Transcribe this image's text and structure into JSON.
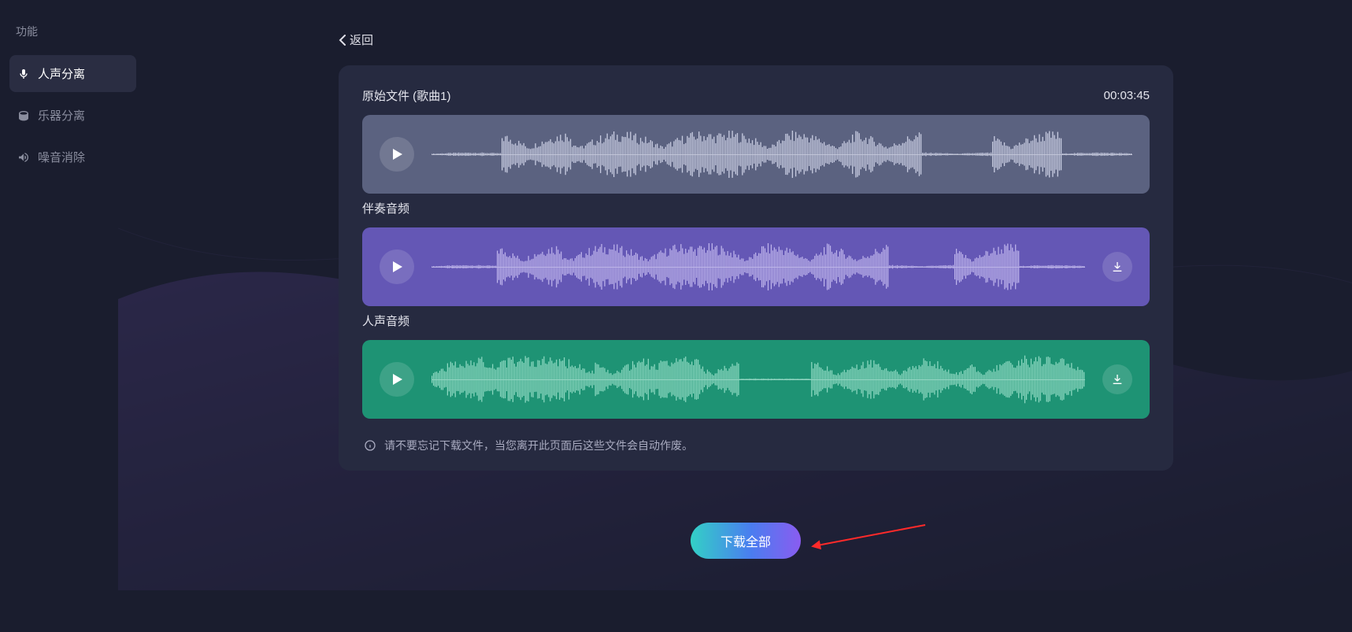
{
  "sidebar": {
    "title": "功能",
    "items": [
      {
        "label": "人声分离",
        "icon": "mic-icon",
        "active": true
      },
      {
        "label": "乐器分离",
        "icon": "drum-icon",
        "active": false
      },
      {
        "label": "噪音消除",
        "icon": "noise-icon",
        "active": false
      }
    ]
  },
  "back_label": "返回",
  "tracks": {
    "original": {
      "title": "原始文件 (歌曲1)",
      "duration": "00:03:45"
    },
    "accompaniment": {
      "title": "伴奏音频"
    },
    "vocal": {
      "title": "人声音频"
    }
  },
  "notice_text": "请不要忘记下载文件，当您离开此页面后这些文件会自动作废。",
  "download_all_label": "下载全部",
  "colors": {
    "panel": "#262a40",
    "track_original": "#5b6280",
    "track_accompaniment": "#6457b5",
    "track_vocal": "#1e9374",
    "wave_light": "#c7cbe0",
    "wave_purple": "#bfb5ec",
    "wave_teal": "#8fd9c2"
  }
}
